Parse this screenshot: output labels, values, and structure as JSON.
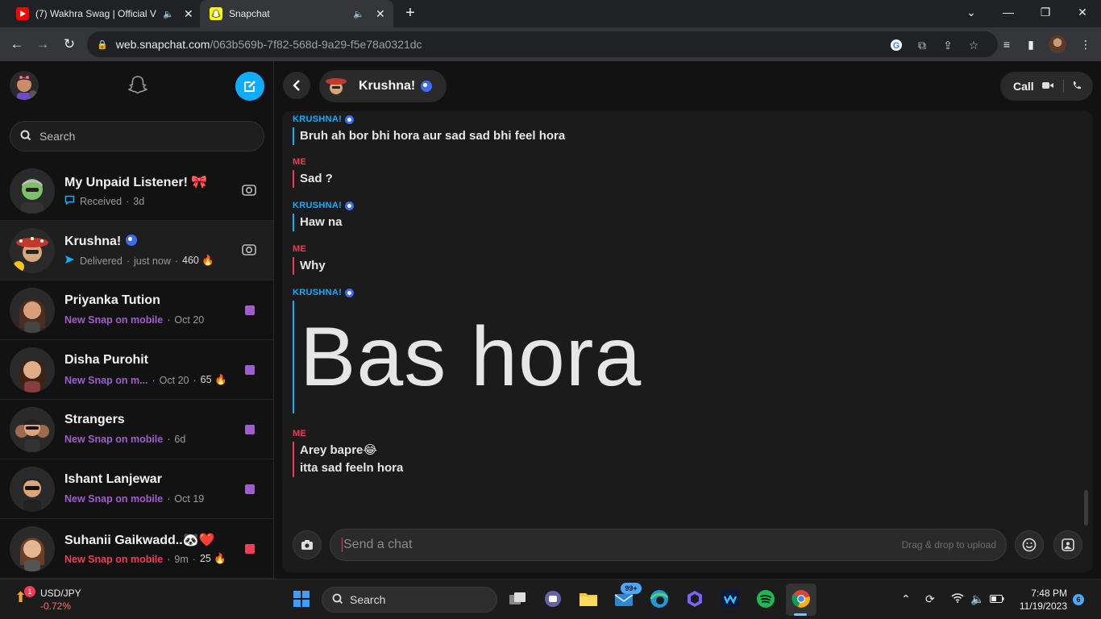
{
  "browser": {
    "tabs": [
      {
        "title": "(7) Wakhra Swag | Official Vi",
        "icon": "youtube-icon"
      },
      {
        "title": "Snapchat",
        "icon": "snapchat-icon"
      }
    ],
    "url_host": "web.snapchat.com",
    "url_path": "/063b569b-7f82-568d-9a29-f5e78a0321dc"
  },
  "sidebar": {
    "search_placeholder": "Search",
    "chats": [
      {
        "name": "My Unpaid Listener! 🎀",
        "status": "Received",
        "time": "3d",
        "extra": "",
        "kind": "received"
      },
      {
        "name": "Krushna!",
        "status": "Delivered",
        "time": "just now",
        "extra": "460 🔥",
        "kind": "delivered"
      },
      {
        "name": "Priyanka Tution",
        "status": "New Snap on mobile",
        "time": "Oct 20",
        "extra": "",
        "kind": "purple"
      },
      {
        "name": "Disha Purohit",
        "status": "New Snap on m...",
        "time": "Oct 20",
        "extra": "65 🔥",
        "kind": "purple"
      },
      {
        "name": "Strangers",
        "status": "New Snap on mobile",
        "time": "6d",
        "extra": "",
        "kind": "purple"
      },
      {
        "name": "Ishant Lanjewar",
        "status": "New Snap on mobile",
        "time": "Oct 19",
        "extra": "",
        "kind": "purple"
      },
      {
        "name": "Suhanii Gaikwadd..🐼❤️",
        "status": "New Snap on mobile",
        "time": "9m",
        "extra": "25 🔥",
        "kind": "red"
      }
    ]
  },
  "conversation": {
    "contact_name": "Krushna!",
    "call_label": "Call",
    "messages": [
      {
        "sender": "KRUSHNA!",
        "from": "them",
        "lines": [
          "Bruh ah bor bhi hora aur sad sad bhi feel hora"
        ]
      },
      {
        "sender": "ME",
        "from": "me",
        "lines": [
          "Sad ?"
        ]
      },
      {
        "sender": "KRUSHNA!",
        "from": "them",
        "lines": [
          "Haw na"
        ]
      },
      {
        "sender": "ME",
        "from": "me",
        "lines": [
          "Why"
        ]
      },
      {
        "sender": "KRUSHNA!",
        "from": "them",
        "lines": [
          "Bas hora"
        ],
        "big": true
      },
      {
        "sender": "ME",
        "from": "me",
        "lines": [
          "Arey bapre😂",
          "itta sad feeln hora"
        ]
      }
    ],
    "input_placeholder": "Send a chat",
    "drop_hint": "Drag & drop to upload"
  },
  "taskbar": {
    "widget_pair": "USD/JPY",
    "widget_change": "-0.72%",
    "widget_badge": "1",
    "search_label": "Search",
    "mail_badge": "99+",
    "time": "7:48 PM",
    "date": "11/19/2023",
    "notification_count": "6"
  },
  "colors": {
    "snap_blue": "#0fadff",
    "me_red": "#f23c57",
    "snap_purple": "#a05dcd"
  }
}
